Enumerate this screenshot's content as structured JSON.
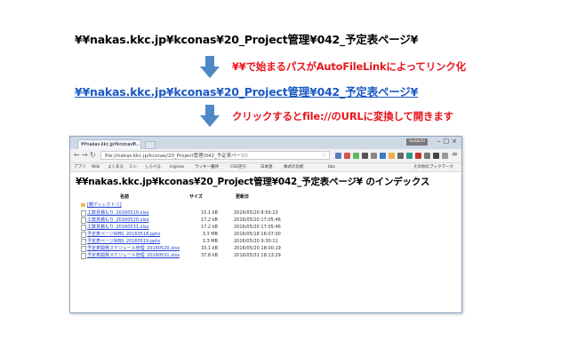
{
  "path_plain": "¥¥nakas.kkc.jp¥kconas¥20_Project管理¥042_予定表ページ¥",
  "path_link": "¥¥nakas.kkc.jp¥kconas¥20_Project管理¥042_予定表ページ¥",
  "note1": "¥¥で始まるパスがAutoFileLinkによってリンク化",
  "note2": "クリックするとfile://のURLに変換して開きます",
  "colors": {
    "note": "#e8151b",
    "link": "#1a59c4",
    "arrow": "#4f88c6"
  },
  "browser": {
    "tab_title": "¥¥nakas.kkc.jp¥kconas¥...",
    "user_badge": "Sudachi",
    "address": "file://nakas.kkc.jp/kconas/20_Project管理/042_予定表ページ/",
    "bookmarks": [
      "アプリ",
      "Wiki",
      "よくある",
      "ミシ",
      "しらべる",
      "ingress",
      "ラッキー優待",
      "CSS逆引",
      "日本語",
      "株式の比較",
      "bbc",
      "その他のブックマーク"
    ],
    "index_title": "¥¥nakas.kkc.jp¥kconas¥20_Project管理¥042_予定表ページ¥ のインデックス",
    "col_name": "名前",
    "col_size": "サイズ",
    "col_date": "更新日",
    "parent_dir": "[親ディレクトリ]",
    "files": [
      {
        "name": "工数見積もり_20160519.xlsx",
        "size": "15.1 kB",
        "date": "2016/05/20 8:56:23"
      },
      {
        "name": "工数見積もり_20160520.xlsx",
        "size": "17.2 kB",
        "date": "2016/05/20 17:05:46"
      },
      {
        "name": "工数見積もり_20160531.xlsx",
        "size": "17.2 kB",
        "date": "2016/05/20 17:05:46"
      },
      {
        "name": "予定表ページWBS_20160518.pptx",
        "size": "3.3 MB",
        "date": "2016/05/18 16:07:00"
      },
      {
        "name": "予定表ページWBS_20160519.pptx",
        "size": "3.3 MB",
        "date": "2016/05/20 9:30:11"
      },
      {
        "name": "予定表開発スケジュール管理_20160520.xlsx",
        "size": "33.1 kB",
        "date": "2016/05/20 18:00:19"
      },
      {
        "name": "予定表開発スケジュール管理_20160531.xlsx",
        "size": "37.8 kB",
        "date": "2016/05/31 18:13:29"
      }
    ]
  }
}
